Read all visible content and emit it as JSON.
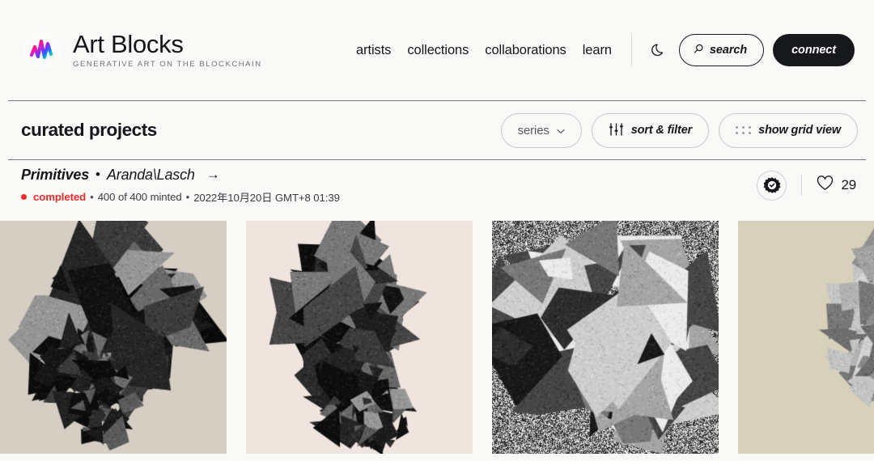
{
  "header": {
    "logo_icon": "artblocks-squiggle-icon",
    "brand_title": "Art Blocks",
    "brand_subtitle": "GENERATIVE ART ON THE BLOCKCHAIN",
    "nav": [
      {
        "label": "artists"
      },
      {
        "label": "collections"
      },
      {
        "label": "collaborations"
      },
      {
        "label": "learn"
      }
    ],
    "theme_toggle_icon": "moon-icon",
    "search_label": "search",
    "search_icon": "search-icon",
    "connect_label": "connect"
  },
  "section": {
    "title": "curated projects",
    "controls": [
      {
        "name": "series-dropdown",
        "label": "series",
        "icon": "chevron-down-icon"
      },
      {
        "name": "sort-filter-button",
        "label": "sort & filter",
        "icon": "sliders-icon"
      },
      {
        "name": "grid-view-button",
        "label": "show grid view",
        "icon": "grid-dots-icon"
      }
    ]
  },
  "project": {
    "name": "Primitives",
    "separator": "•",
    "artist": "Aranda\\Lasch",
    "arrow": "→",
    "status": "completed",
    "minted": "400 of 400 minted",
    "timestamp": "2022年10月20日 GMT+8 01:39",
    "meta_separator": "•",
    "curated_badge_icon": "verified-badge-icon",
    "like_icon": "heart-icon",
    "like_count": "29"
  },
  "thumbnails": [
    {
      "name": "artwork-tile-1",
      "bg": "#d4cec3",
      "style": "dense-black-polyhedron",
      "seed": 11
    },
    {
      "name": "artwork-tile-2",
      "bg": "#f0e4df",
      "style": "vertical-black-drape",
      "seed": 27
    },
    {
      "name": "artwork-tile-3",
      "bg": "#bdbdbd",
      "style": "noise-field-facets",
      "seed": 43
    },
    {
      "name": "artwork-tile-4",
      "bg": "#d7d1bb",
      "style": "light-stippled-cluster",
      "seed": 61
    }
  ],
  "colors": {
    "page_bg": "#f9f9f8",
    "ink": "#15171c",
    "rule": "#7b7c80",
    "accent_red": "#ed2b2b",
    "muted": "#55585e"
  }
}
